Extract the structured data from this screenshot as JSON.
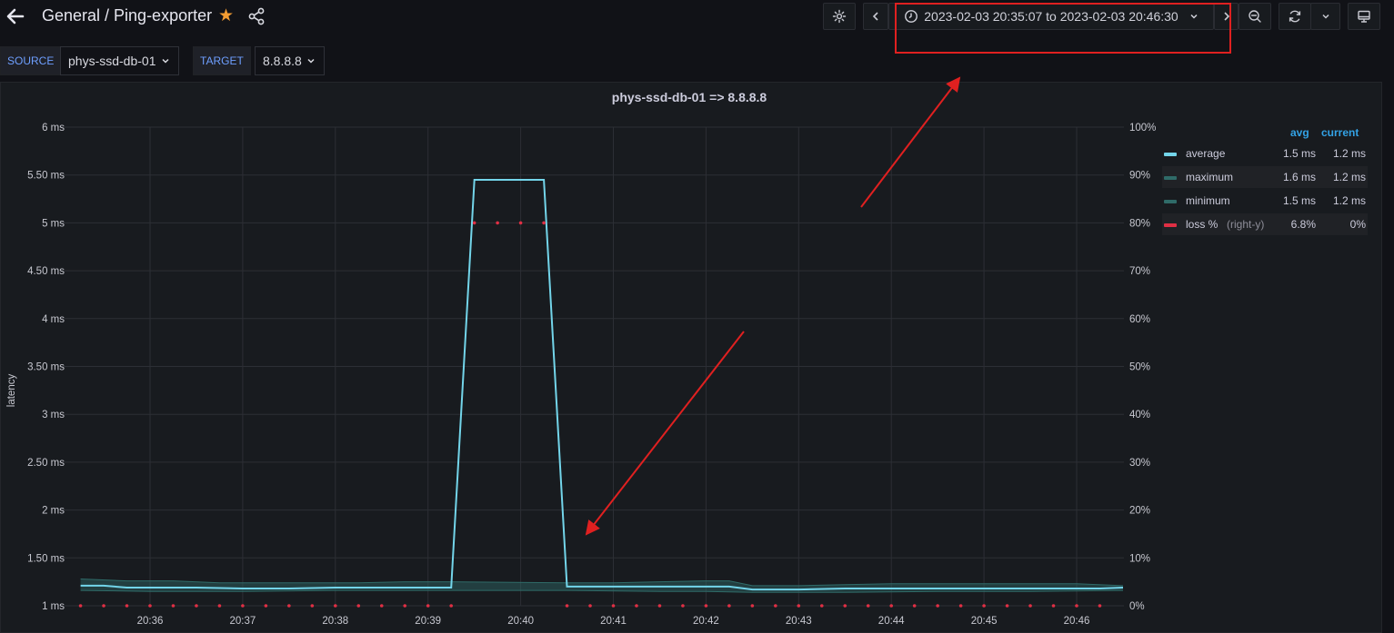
{
  "header": {
    "breadcrumb": "General / Ping-exporter",
    "time_range": "2023-02-03 20:35:07 to 2023-02-03 20:46:30"
  },
  "variables": [
    {
      "label": "SOURCE",
      "value": "phys-ssd-db-01"
    },
    {
      "label": "TARGET",
      "value": "8.8.8.8"
    }
  ],
  "panel": {
    "title": "phys-ssd-db-01 => 8.8.8.8"
  },
  "legend": {
    "columns": [
      "avg",
      "current"
    ],
    "items": [
      {
        "name": "average",
        "suffix": "",
        "avg": "1.5 ms",
        "current": "1.2 ms",
        "color": "#73d5ea"
      },
      {
        "name": "maximum",
        "suffix": "",
        "avg": "1.6 ms",
        "current": "1.2 ms",
        "color": "#2f6b68"
      },
      {
        "name": "minimum",
        "suffix": "",
        "avg": "1.5 ms",
        "current": "1.2 ms",
        "color": "#2f6b68"
      },
      {
        "name": "loss %",
        "suffix": "(right-y)",
        "avg": "6.8%",
        "current": "0%",
        "color": "#e02f44"
      }
    ]
  },
  "colors": {
    "accent": "#6e9fff",
    "star": "#f39c32",
    "annotation": "#e02020"
  },
  "chart_data": {
    "type": "line",
    "title": "phys-ssd-db-01 => 8.8.8.8",
    "ylabel": "latency",
    "ylim": [
      1,
      6
    ],
    "y2lim": [
      0,
      100
    ],
    "y_ticks": [
      "1 ms",
      "1.50 ms",
      "2 ms",
      "2.50 ms",
      "3 ms",
      "3.50 ms",
      "4 ms",
      "4.50 ms",
      "5 ms",
      "5.50 ms",
      "6 ms"
    ],
    "y2_ticks": [
      "0%",
      "10%",
      "20%",
      "30%",
      "40%",
      "50%",
      "60%",
      "70%",
      "80%",
      "90%",
      "100%"
    ],
    "x_ticks": [
      "20:36",
      "20:37",
      "20:38",
      "20:39",
      "20:40",
      "20:41",
      "20:42",
      "20:43",
      "20:44",
      "20:45",
      "20:46"
    ],
    "grid": true,
    "legend_position": "right",
    "series": [
      {
        "name": "average",
        "x": [
          "20:35:15",
          "20:35:30",
          "20:35:45",
          "20:36:30",
          "20:37:00",
          "20:37:30",
          "20:38:00",
          "20:38:30",
          "20:39:00",
          "20:39:15",
          "20:39:30",
          "20:40:00",
          "20:40:15",
          "20:40:30",
          "20:41:00",
          "20:41:30",
          "20:42:00",
          "20:42:15",
          "20:42:30",
          "20:43:00",
          "20:43:30",
          "20:44:00",
          "20:44:30",
          "20:45:00",
          "20:45:30",
          "20:46:00",
          "20:46:15",
          "20:46:30"
        ],
        "values": [
          1.21,
          1.21,
          1.19,
          1.19,
          1.18,
          1.18,
          1.19,
          1.19,
          1.19,
          1.19,
          5.45,
          5.45,
          5.45,
          1.2,
          1.2,
          1.2,
          1.2,
          1.2,
          1.17,
          1.17,
          1.18,
          1.18,
          1.18,
          1.18,
          1.18,
          1.18,
          1.18,
          1.19
        ]
      },
      {
        "name": "maximum",
        "x": [
          "20:35:15",
          "20:35:45",
          "20:36:15",
          "20:36:45",
          "20:37:30",
          "20:38:15",
          "20:38:45",
          "20:39:15",
          "20:40:30",
          "20:41:00",
          "20:41:30",
          "20:42:00",
          "20:42:15",
          "20:42:30",
          "20:43:00",
          "20:43:30",
          "20:44:00",
          "20:44:30",
          "20:45:00",
          "20:45:30",
          "20:46:00",
          "20:46:30"
        ],
        "values": [
          1.28,
          1.26,
          1.26,
          1.24,
          1.24,
          1.24,
          1.25,
          1.25,
          1.24,
          1.24,
          1.25,
          1.26,
          1.26,
          1.21,
          1.21,
          1.22,
          1.23,
          1.23,
          1.23,
          1.23,
          1.23,
          1.21
        ]
      },
      {
        "name": "minimum",
        "x": [
          "20:35:15",
          "20:36:00",
          "20:37:00",
          "20:38:00",
          "20:39:15",
          "20:40:30",
          "20:41:30",
          "20:42:00",
          "20:42:30",
          "20:43:30",
          "20:44:30",
          "20:45:30",
          "20:46:30"
        ],
        "values": [
          1.16,
          1.15,
          1.15,
          1.16,
          1.16,
          1.16,
          1.15,
          1.15,
          1.14,
          1.14,
          1.15,
          1.15,
          1.16
        ]
      },
      {
        "name": "loss %",
        "axis": "right",
        "x": [
          "20:35:15",
          "20:35:30",
          "20:35:45",
          "20:36:00",
          "20:36:15",
          "20:36:30",
          "20:36:45",
          "20:37:00",
          "20:37:15",
          "20:37:30",
          "20:37:45",
          "20:38:00",
          "20:38:15",
          "20:38:30",
          "20:38:45",
          "20:39:00",
          "20:39:15",
          "20:39:30",
          "20:39:45",
          "20:40:00",
          "20:40:15",
          "20:40:30",
          "20:40:45",
          "20:41:00",
          "20:41:15",
          "20:41:30",
          "20:41:45",
          "20:42:00",
          "20:42:15",
          "20:42:30",
          "20:42:45",
          "20:43:00",
          "20:43:15",
          "20:43:30",
          "20:43:45",
          "20:44:00",
          "20:44:15",
          "20:44:30",
          "20:44:45",
          "20:45:00",
          "20:45:15",
          "20:45:30",
          "20:45:45",
          "20:46:00",
          "20:46:15"
        ],
        "values": [
          0,
          0,
          0,
          0,
          0,
          0,
          0,
          0,
          0,
          0,
          0,
          0,
          0,
          0,
          0,
          0,
          0,
          80,
          80,
          80,
          80,
          0,
          0,
          0,
          0,
          0,
          0,
          0,
          0,
          0,
          0,
          0,
          0,
          0,
          0,
          0,
          0,
          0,
          0,
          0,
          0,
          0,
          0,
          0,
          0
        ]
      }
    ]
  }
}
